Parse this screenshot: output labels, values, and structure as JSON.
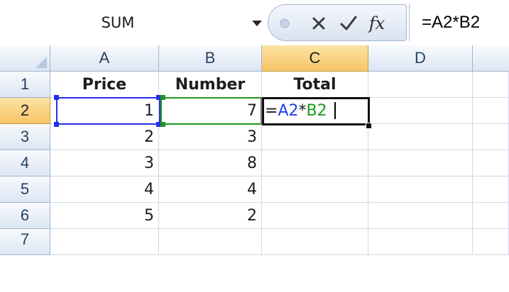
{
  "formula_bar": {
    "name_box": "SUM",
    "formula": "=A2*B2",
    "icons": [
      "dropdown-arrow-icon",
      "cancel-x-icon",
      "enter-check-icon",
      "insert-function-icon"
    ],
    "insert_function_label": "fx"
  },
  "grid": {
    "columns": [
      "A",
      "B",
      "C",
      "D"
    ],
    "rows": [
      "1",
      "2",
      "3",
      "4",
      "5",
      "6",
      "7"
    ],
    "active_row": "2",
    "active_column": "C",
    "cells": {
      "A1": "Price",
      "B1": "Number",
      "C1": "Total",
      "A2": "1",
      "B2": "7",
      "A3": "2",
      "B3": "3",
      "A4": "3",
      "B4": "8",
      "A5": "4",
      "B5": "4",
      "A6": "5",
      "B6": "2"
    },
    "editing_formula": {
      "eq": "=",
      "ref_a": "A2",
      "op": "*",
      "ref_b": "B2"
    }
  },
  "colors": {
    "ref_a": "#1f3ff0",
    "ref_b": "#1c9a1c",
    "header_active": "#f7c566"
  }
}
